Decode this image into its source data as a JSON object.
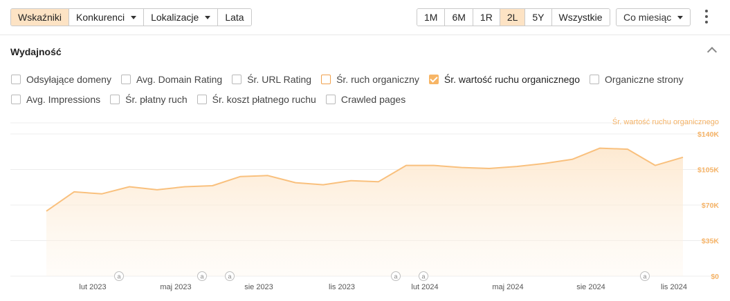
{
  "toolbar": {
    "left_tabs": [
      {
        "label": "Wskaźniki",
        "active": true,
        "dropdown": false
      },
      {
        "label": "Konkurenci",
        "active": false,
        "dropdown": true
      },
      {
        "label": "Lokalizacje",
        "active": false,
        "dropdown": true
      },
      {
        "label": "Lata",
        "active": false,
        "dropdown": false
      }
    ],
    "ranges": [
      {
        "label": "1M",
        "active": false
      },
      {
        "label": "6M",
        "active": false
      },
      {
        "label": "1R",
        "active": false
      },
      {
        "label": "2L",
        "active": true
      },
      {
        "label": "5Y",
        "active": false
      },
      {
        "label": "Wszystkie",
        "active": false
      }
    ],
    "interval": "Co miesiąc",
    "more_icon": "kebab-icon"
  },
  "section": {
    "title": "Wydajność",
    "collapse_icon": "chevron-up-icon"
  },
  "metrics_row1": [
    {
      "label": "Odsyłające domeny",
      "state": "off"
    },
    {
      "label": "Avg. Domain Rating",
      "state": "off"
    },
    {
      "label": "Śr. URL Rating",
      "state": "off"
    },
    {
      "label": "Śr. ruch organiczny",
      "state": "highlight"
    },
    {
      "label": "Śr. wartość ruchu organicznego",
      "state": "checked"
    },
    {
      "label": "Organiczne strony",
      "state": "off"
    }
  ],
  "metrics_row2": [
    {
      "label": "Avg. Impressions",
      "state": "off"
    },
    {
      "label": "Śr. płatny ruch",
      "state": "off"
    },
    {
      "label": "Śr. koszt płatnego ruchu",
      "state": "off"
    },
    {
      "label": "Crawled pages",
      "state": "off"
    }
  ],
  "chart_data": {
    "type": "area",
    "series": [
      {
        "name": "Śr. wartość ruchu organicznego",
        "values": [
          64000,
          83000,
          81000,
          88000,
          85000,
          88000,
          89000,
          98000,
          99000,
          92000,
          90000,
          94000,
          93000,
          109000,
          109000,
          107000,
          106000,
          108000,
          111000,
          115000,
          126000,
          125000,
          109000,
          117000
        ]
      }
    ],
    "x": [
      "2022-12",
      "2023-01",
      "2023-02",
      "2023-03",
      "2023-04",
      "2023-05",
      "2023-06",
      "2023-07",
      "2023-08",
      "2023-09",
      "2023-10",
      "2023-11",
      "2023-12",
      "2024-01",
      "2024-02",
      "2024-03",
      "2024-04",
      "2024-05",
      "2024-06",
      "2024-07",
      "2024-08",
      "2024-09",
      "2024-10",
      "2024-11"
    ],
    "x_tick_labels": [
      "lut 2023",
      "maj 2023",
      "sie 2023",
      "lis 2023",
      "lut 2024",
      "maj 2024",
      "sie 2024",
      "lis 2024"
    ],
    "y_tick_labels": [
      "$140K",
      "$105K",
      "$70K",
      "$35K",
      "$0"
    ],
    "ylim": [
      0,
      140000
    ],
    "y_axis_title": "Śr. wartość ruchu organicznego",
    "annotation_marker": "a",
    "annotation_months": [
      "2023-03",
      "2023-06",
      "2023-07",
      "2024-01",
      "2024-02",
      "2024-10"
    ],
    "grid": true,
    "color": "#f9c07d"
  }
}
